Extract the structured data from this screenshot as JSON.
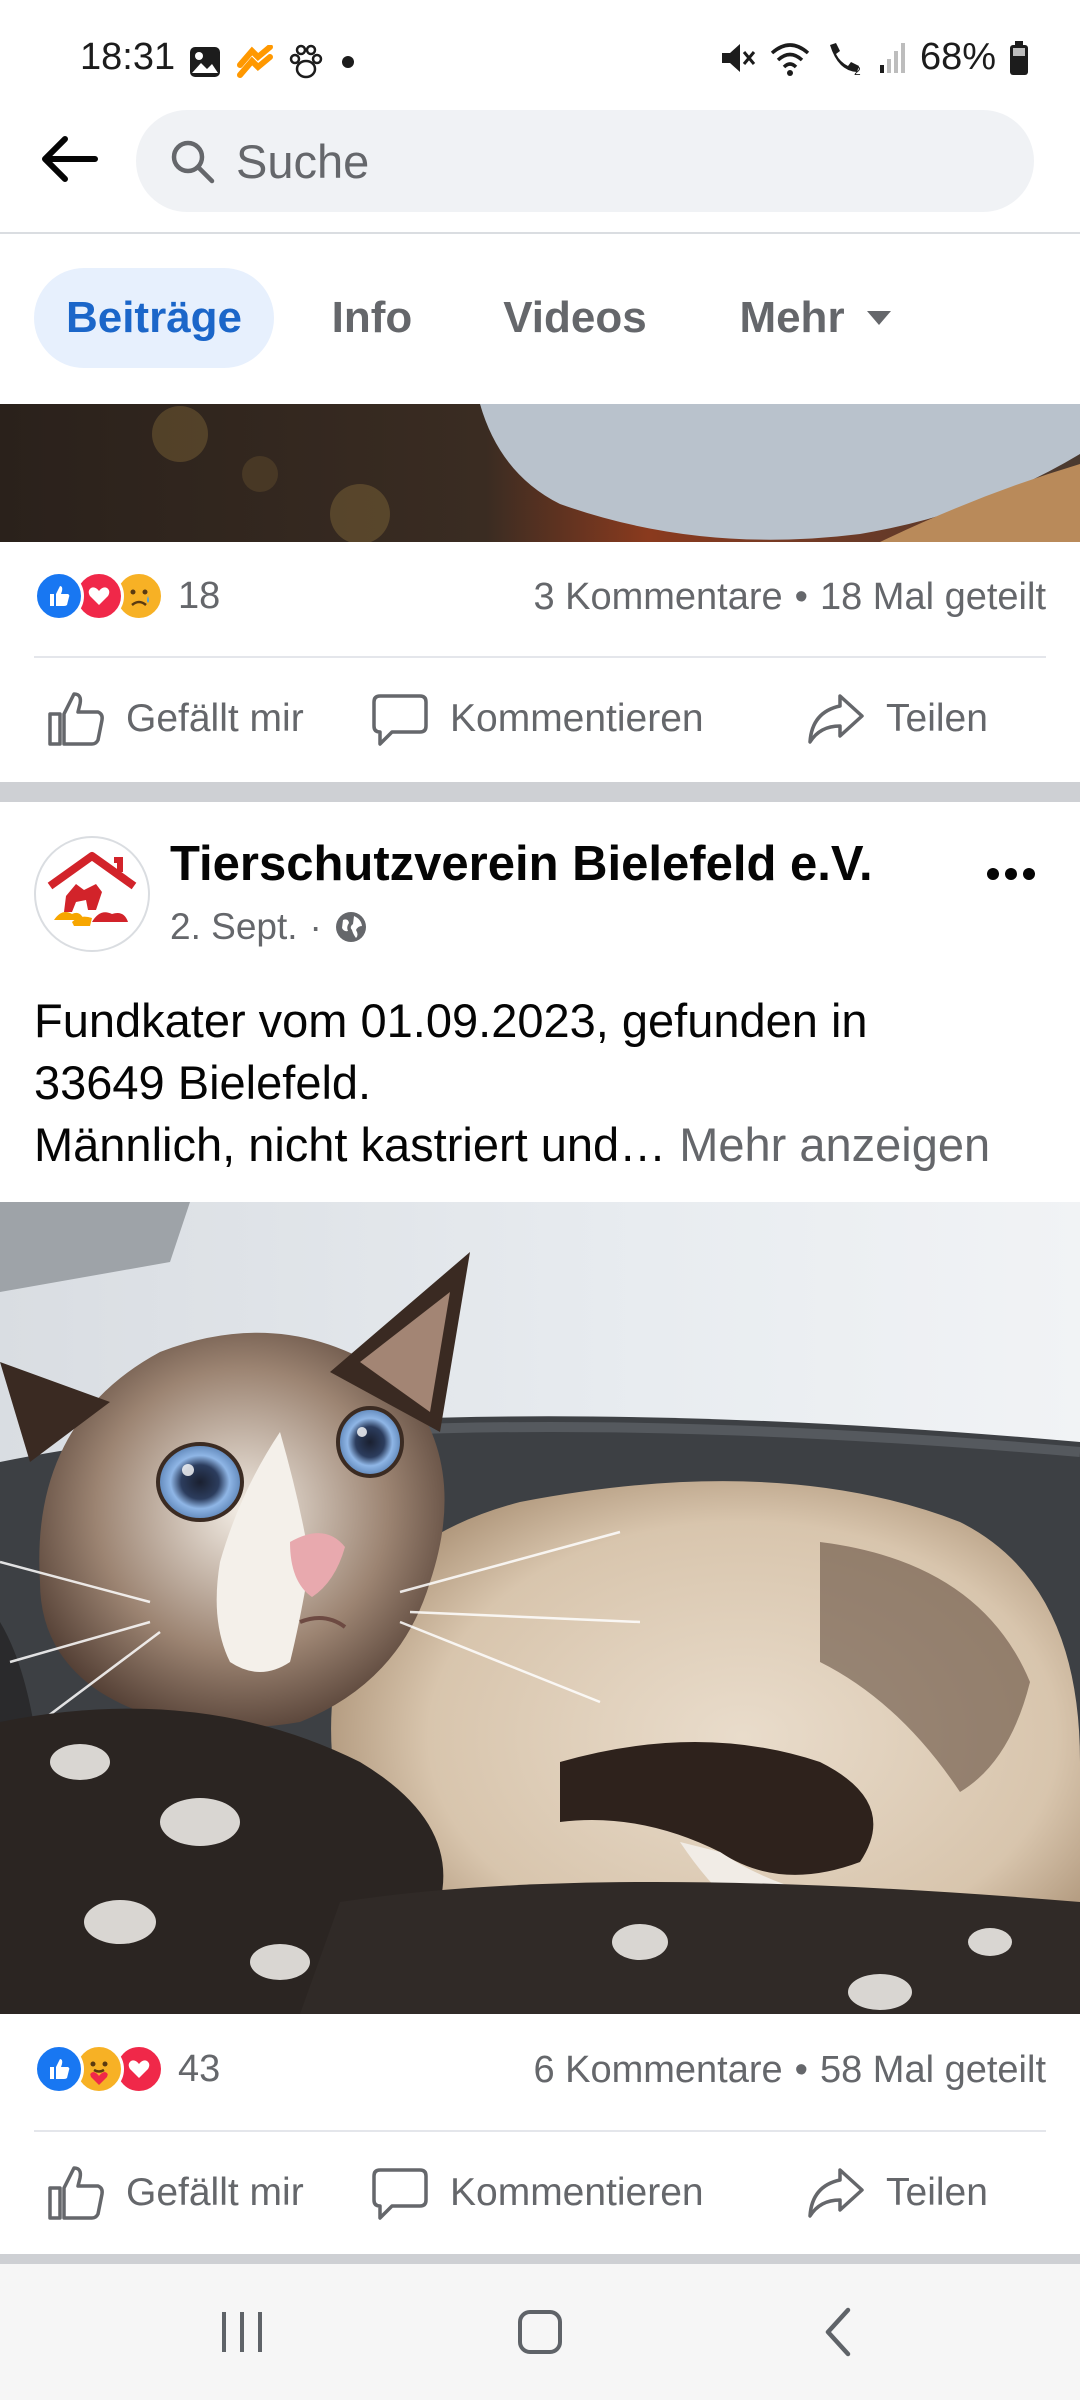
{
  "status_bar": {
    "time": "18:31",
    "left_icons": [
      "gallery-icon",
      "app-notification-icon",
      "paw-icon",
      "dot-icon"
    ],
    "right_icons": [
      "mute-icon",
      "wifi-icon",
      "wifi-call-icon",
      "signal-icon",
      "battery-icon"
    ],
    "battery": "68%"
  },
  "search": {
    "placeholder": "Suche"
  },
  "tabs": [
    {
      "label": "Beiträge",
      "active": true
    },
    {
      "label": "Info",
      "active": false
    },
    {
      "label": "Videos",
      "active": false
    },
    {
      "label": "Mehr",
      "active": false
    }
  ],
  "posts": [
    {
      "reactions": [
        "like",
        "love",
        "sad"
      ],
      "reaction_count": "18",
      "comments": "3 Kommentare",
      "separator": "•",
      "shares": "18 Mal geteilt",
      "actions": {
        "like": "Gefällt mir",
        "comment": "Kommentieren",
        "share": "Teilen"
      }
    },
    {
      "page_name": "Tierschutzverein Bielefeld e.V.",
      "date": "2. Sept.",
      "meta_separator": "·",
      "text_line1": "Fundkater vom 01.09.2023, gefunden in",
      "text_line2": "33649 Bielefeld.",
      "text_line3": "Männlich, nicht kastriert und…",
      "see_more": "Mehr anzeigen",
      "reactions": [
        "like",
        "care",
        "love"
      ],
      "reaction_count": "43",
      "comments": "6 Kommentare",
      "separator": "•",
      "shares": "58 Mal geteilt",
      "actions": {
        "like": "Gefällt mir",
        "comment": "Kommentieren",
        "share": "Teilen"
      }
    }
  ],
  "colors": {
    "accent": "#1b66c9",
    "tab_active_bg": "#e7f0fd",
    "secondary_text": "#65676b",
    "like_blue": "#1877f2",
    "love_red": "#f02849",
    "emoji_yellow": "#f7b125"
  }
}
